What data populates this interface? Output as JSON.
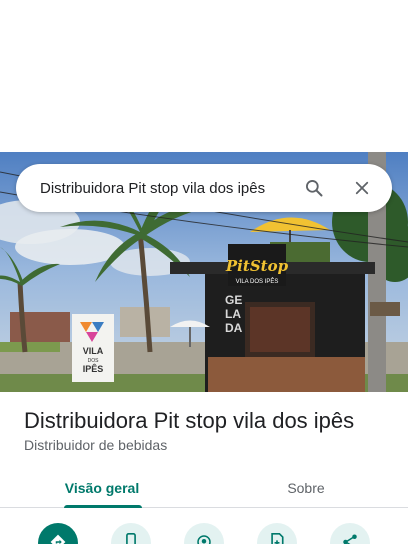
{
  "search": {
    "query": "Distribuidora Pit stop vila dos ipês"
  },
  "icons": {
    "search": "search-icon",
    "close": "close-icon"
  },
  "place": {
    "title": "Distribuidora Pit stop vila dos ipês",
    "category": "Distribuidor de bebidas"
  },
  "photo_signs": {
    "pitstop_logo": "PitStop",
    "pitstop_sub": "VILA DOS IPÊS",
    "vila_line1": "VILA",
    "vila_line2": "DOS",
    "vila_line3": "IPÊS",
    "gelada_1": "GE",
    "gelada_2": "LA",
    "gelada_3": "DA"
  },
  "tabs": [
    {
      "label": "Visão geral",
      "active": true
    },
    {
      "label": "Sobre",
      "active": false
    }
  ],
  "actions": [
    {
      "icon": "directions-icon"
    },
    {
      "icon": "phone-icon"
    },
    {
      "icon": "location-icon"
    },
    {
      "icon": "save-icon"
    },
    {
      "icon": "share-icon"
    }
  ],
  "colors": {
    "accent": "#00796b",
    "action_bg": "#e3f2f1"
  }
}
